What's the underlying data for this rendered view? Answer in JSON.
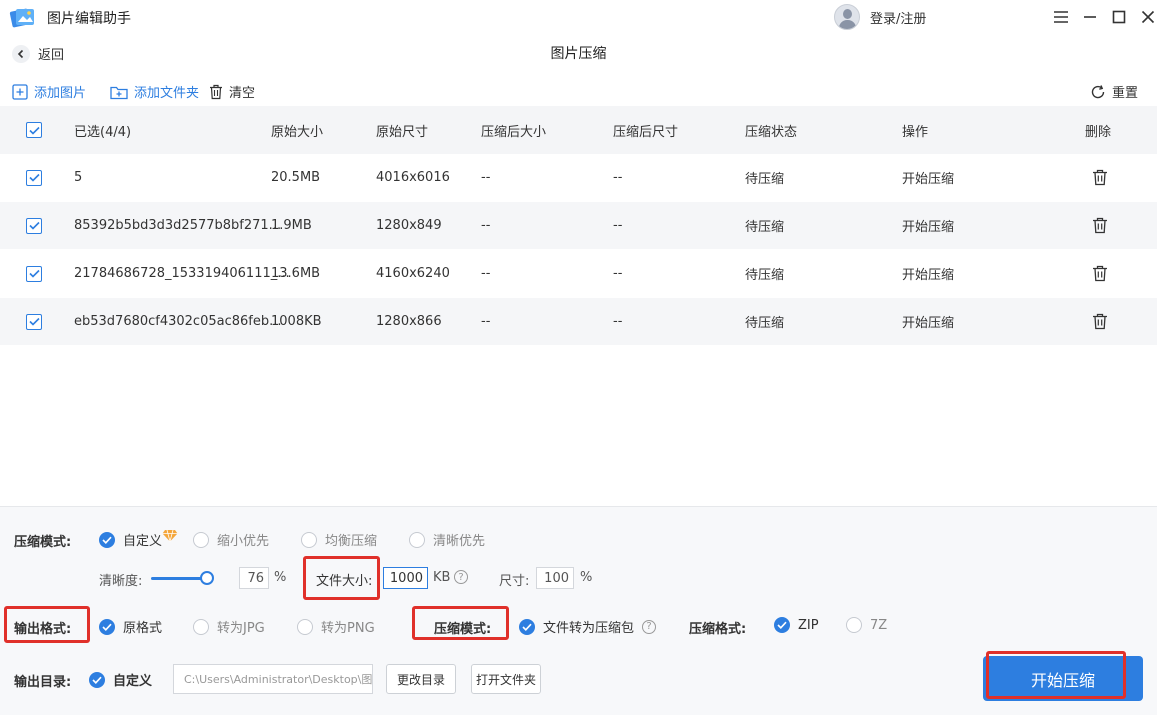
{
  "app": {
    "title": "图片编辑助手",
    "login_label": "登录/注册"
  },
  "header": {
    "back_label": "返回",
    "page_title": "图片压缩"
  },
  "toolbar": {
    "add_image": "添加图片",
    "add_folder": "添加文件夹",
    "clear": "清空",
    "reset": "重置"
  },
  "table": {
    "headers": {
      "selected": "已选(4/4)",
      "orig_size": "原始大小",
      "orig_dim": "原始尺寸",
      "comp_size": "压缩后大小",
      "comp_dim": "压缩后尺寸",
      "status": "压缩状态",
      "action": "操作",
      "delete": "删除"
    },
    "rows": [
      {
        "name": "5",
        "orig_size": "20.5MB",
        "orig_dim": "4016x6016",
        "comp_size": "--",
        "comp_dim": "--",
        "status": "待压缩",
        "action": "开始压缩"
      },
      {
        "name": "85392b5bd3d3d2577b8bf271...",
        "orig_size": "1.9MB",
        "orig_dim": "1280x849",
        "comp_size": "--",
        "comp_dim": "--",
        "status": "待压缩",
        "action": "开始压缩"
      },
      {
        "name": "21784686728_153319406111_...",
        "orig_size": "13.6MB",
        "orig_dim": "4160x6240",
        "comp_size": "--",
        "comp_dim": "--",
        "status": "待压缩",
        "action": "开始压缩"
      },
      {
        "name": "eb53d7680cf4302c05ac86feb...",
        "orig_size": "1008KB",
        "orig_dim": "1280x866",
        "comp_size": "--",
        "comp_dim": "--",
        "status": "待压缩",
        "action": "开始压缩"
      }
    ]
  },
  "settings": {
    "compress_mode_label": "压缩模式:",
    "mode_custom": "自定义",
    "mode_shrink": "缩小优先",
    "mode_balance": "均衡压缩",
    "mode_clear": "清晰优先",
    "clarity_label": "清晰度:",
    "clarity_value": "76",
    "clarity_percent": 0.76,
    "percent_unit": "%",
    "filesize_label": "文件大小:",
    "filesize_value": "1000",
    "filesize_unit": "KB",
    "dim_label": "尺寸:",
    "dim_value": "100",
    "output_format_label": "输出格式:",
    "fmt_original": "原格式",
    "fmt_jpg": "转为JPG",
    "fmt_png": "转为PNG",
    "compress_mode2_label": "压缩模式:",
    "to_archive": "文件转为压缩包",
    "archive_format_label": "压缩格式:",
    "zip": "ZIP",
    "sevenz": "7Z",
    "output_dir_label": "输出目录:",
    "dir_custom": "自定义",
    "dir_path": "C:\\Users\\Administrator\\Desktop\\图",
    "change_dir": "更改目录",
    "open_folder": "打开文件夹",
    "start": "开始压缩"
  },
  "colors": {
    "accent": "#2d7ee0",
    "highlight": "#e0302a"
  }
}
